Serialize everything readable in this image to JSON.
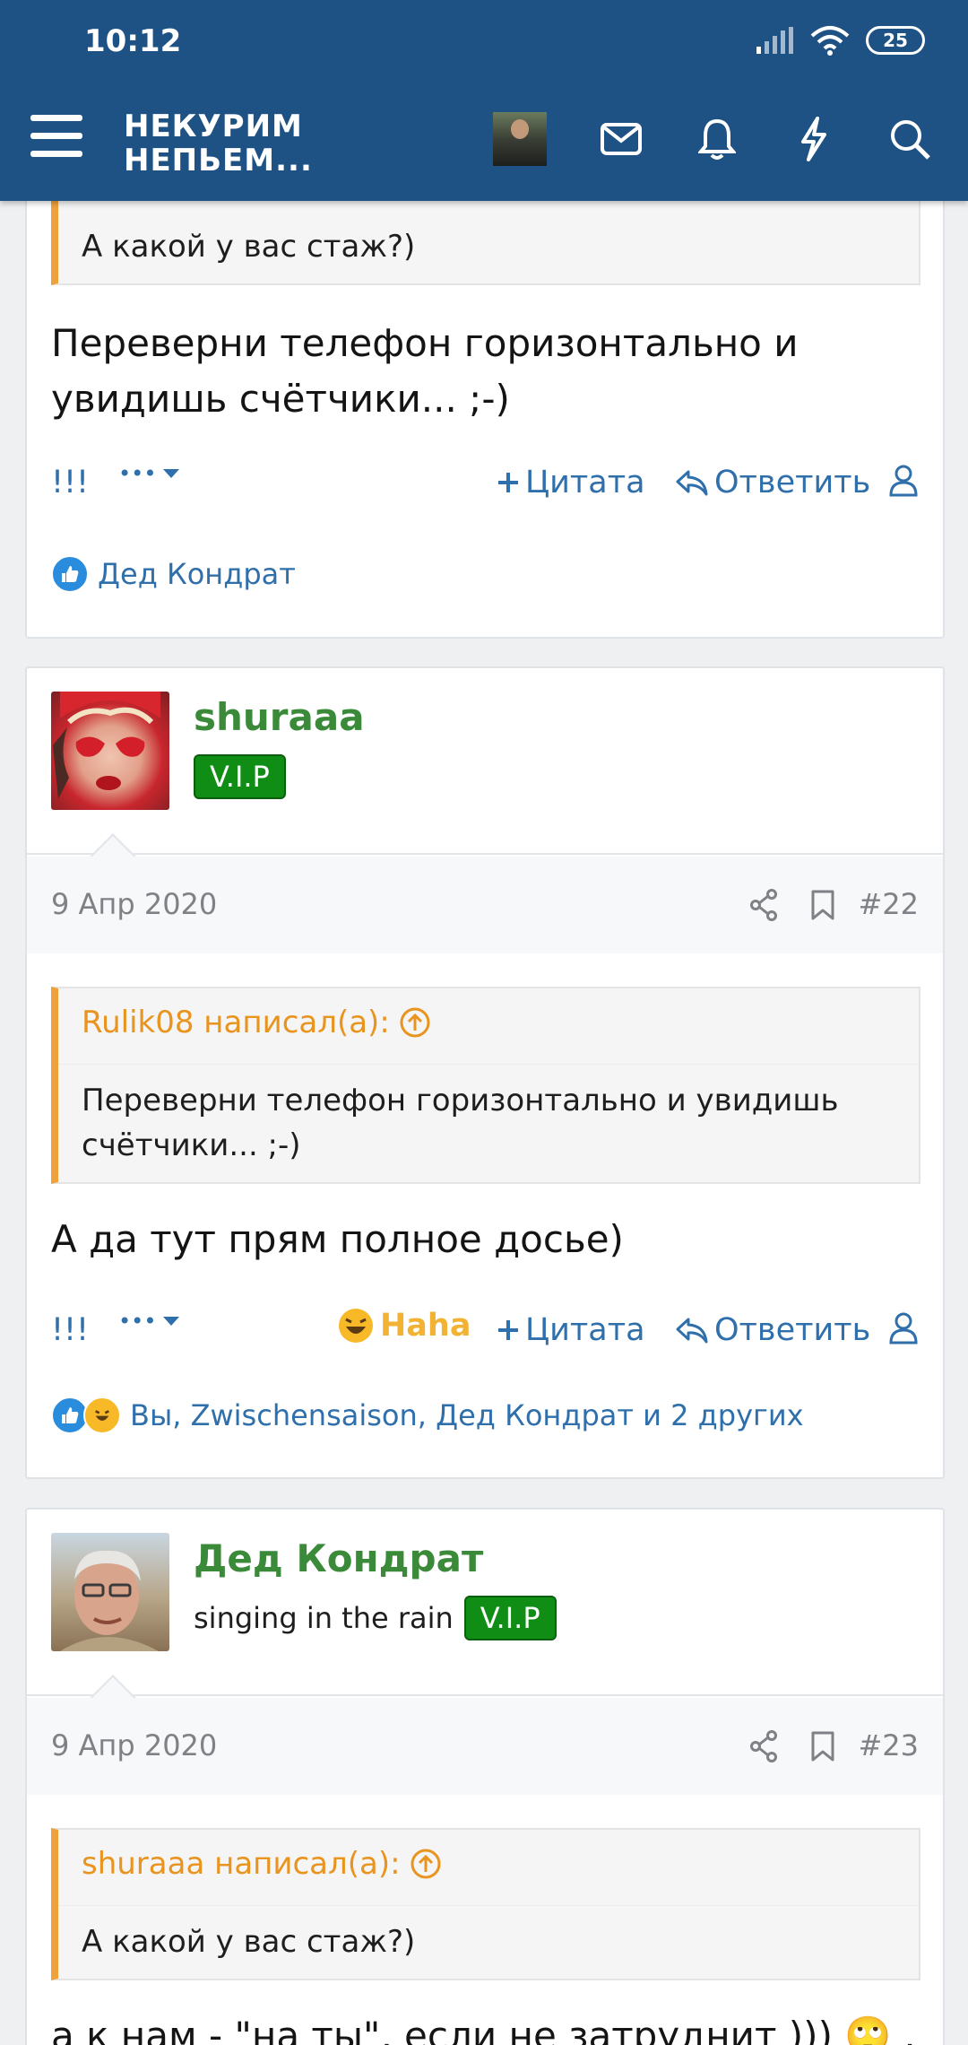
{
  "status": {
    "time": "10:12",
    "battery": "25"
  },
  "header": {
    "logo_line1": "НЕКУРИМ",
    "logo_line2": "НЕПЬЕМ..."
  },
  "actions": {
    "exclam": "!!!",
    "more": "•••",
    "quote": "Цитата",
    "reply": "Ответить",
    "haha": "Haha"
  },
  "post1": {
    "quote_text": "А какой у вас стаж?)",
    "body": "Переверни телефон горизонтально и увидишь счётчики... ;-)",
    "reactions": "Дед Кондрат"
  },
  "post2": {
    "username": "shuraaa",
    "badge": "V.I.P",
    "date": "9 Апр 2020",
    "number": "#22",
    "quote_author": "Rulik08 написал(а):",
    "quote_text": "Переверни телефон горизонтально и увидишь счётчики... ;-)",
    "body": "А да тут прям полное досье)",
    "reactions": "Вы, Zwischensaison, Дед Кондрат и 2 других"
  },
  "post3": {
    "username": "Дед Кондрат",
    "title": "singing in the rain",
    "badge": "V.I.P",
    "date": "9 Апр 2020",
    "number": "#23",
    "quote_author": "shuraaa написал(а):",
    "quote_text": "А какой у вас стаж?)",
    "body": "а к нам - \"на ты\", если не затруднит ))) 🙄 , как"
  },
  "colors": {
    "header": "#1e5285",
    "link": "#2f6fab",
    "quote_accent": "#f0a23a",
    "username": "#3a8a3a",
    "vip": "#0f8d14"
  }
}
